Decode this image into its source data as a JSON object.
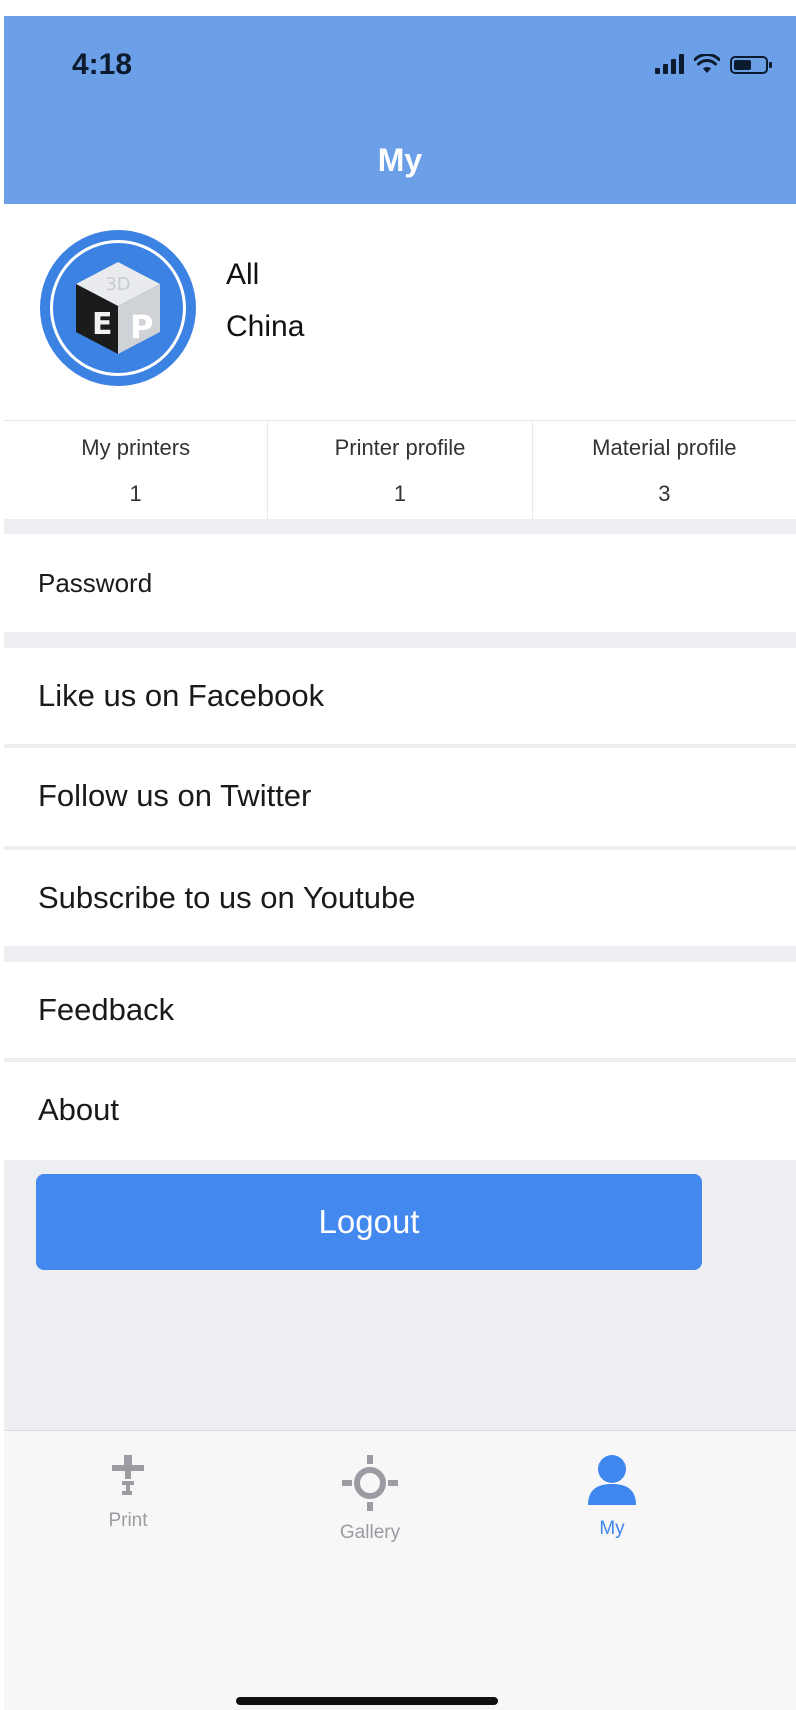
{
  "status_bar": {
    "time": "4:18",
    "battery_level": 0.55
  },
  "header": {
    "title": "My"
  },
  "profile": {
    "name": "All",
    "region": "China",
    "avatar_icon": "3dp-cube-logo"
  },
  "stats": [
    {
      "label": "My printers",
      "value": "1"
    },
    {
      "label": "Printer profile",
      "value": "1"
    },
    {
      "label": "Material profile",
      "value": "3"
    }
  ],
  "menu": {
    "password": "Password",
    "facebook": "Like us on Facebook",
    "twitter": "Follow us on Twitter",
    "youtube": "Subscribe to us on Youtube",
    "feedback": "Feedback",
    "about": "About"
  },
  "logout_label": "Logout",
  "tabs": [
    {
      "label": "Print",
      "icon": "print-nozzle-icon",
      "active": false
    },
    {
      "label": "Gallery",
      "icon": "gallery-icon",
      "active": false
    },
    {
      "label": "My",
      "icon": "user-icon",
      "active": true
    }
  ],
  "colors": {
    "header": "#6b9fe8",
    "accent": "#4388ee",
    "avatar": "#3c82e3"
  }
}
